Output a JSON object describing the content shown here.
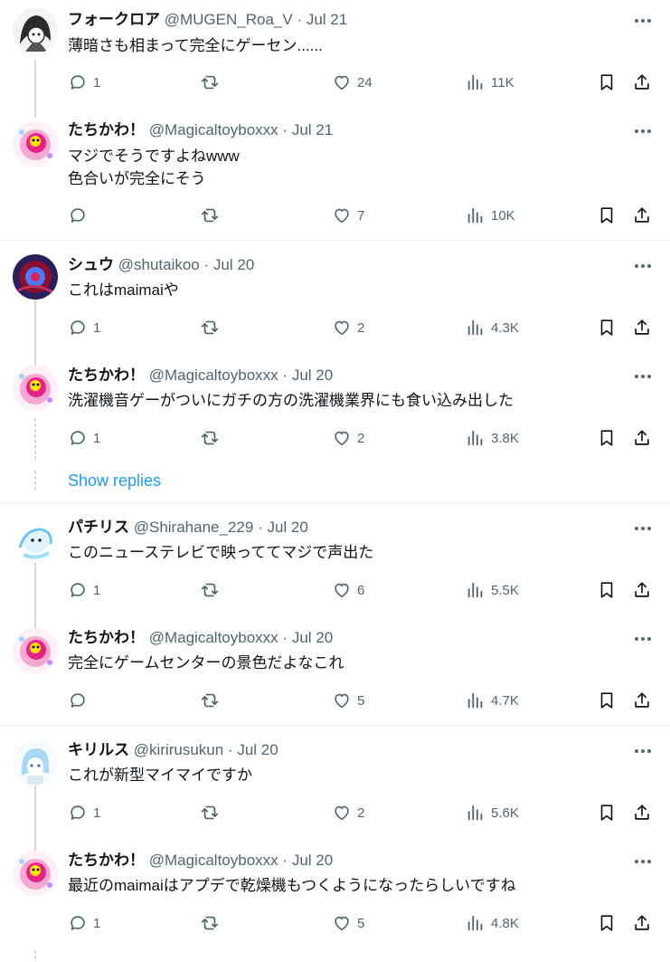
{
  "replies": [
    {
      "name": "フォークロア",
      "handle": "@MUGEN_Roa_V",
      "date": "Jul 21",
      "text": "薄暗さも相まって完全にゲーセン......",
      "counts": {
        "reply": "1",
        "retweet": "",
        "like": "24",
        "views": "11K"
      }
    },
    {
      "name": "たちかわ！",
      "handle": "@Magicaltoyboxxx",
      "date": "Jul 21",
      "text": "マジでそうですよねwww\n色合いが完全にそう",
      "counts": {
        "reply": "",
        "retweet": "",
        "like": "7",
        "views": "10K"
      }
    },
    {
      "name": "シュウ",
      "handle": "@shutaikoo",
      "date": "Jul 20",
      "text": "これはmaimaiや",
      "counts": {
        "reply": "1",
        "retweet": "",
        "like": "2",
        "views": "4.3K"
      }
    },
    {
      "name": "たちかわ！",
      "handle": "@Magicaltoyboxxx",
      "date": "Jul 20",
      "text": "洗濯機音ゲーがついにガチの方の洗濯機業界にも食い込み出した",
      "counts": {
        "reply": "1",
        "retweet": "",
        "like": "2",
        "views": "3.8K"
      }
    },
    {
      "name": "パチリス",
      "handle": "@Shirahane_229",
      "date": "Jul 20",
      "text": "このニューステレビで映っててマジで声出た",
      "counts": {
        "reply": "1",
        "retweet": "",
        "like": "6",
        "views": "5.5K"
      }
    },
    {
      "name": "たちかわ！",
      "handle": "@Magicaltoyboxxx",
      "date": "Jul 20",
      "text": "完全にゲームセンターの景色だよなこれ",
      "counts": {
        "reply": "",
        "retweet": "",
        "like": "5",
        "views": "4.7K"
      }
    },
    {
      "name": "キリルス",
      "handle": "@kirirusukun",
      "date": "Jul 20",
      "text": "これが新型マイマイですか",
      "counts": {
        "reply": "1",
        "retweet": "",
        "like": "2",
        "views": "5.6K"
      }
    },
    {
      "name": "たちかわ！",
      "handle": "@Magicaltoyboxxx",
      "date": "Jul 20",
      "text": "最近のmaimaiはアプデで乾燥機もつくようになったらしいですね",
      "counts": {
        "reply": "1",
        "retweet": "",
        "like": "5",
        "views": "4.8K"
      }
    }
  ],
  "show_replies_label": "Show replies",
  "colors": {
    "text": "#0f1419",
    "meta": "#536471",
    "link": "#1d9bf0",
    "line": "#cfd9de"
  },
  "icons": [
    "reply-icon",
    "retweet-icon",
    "like-icon",
    "views-icon",
    "bookmark-icon",
    "share-icon",
    "more-icon"
  ]
}
